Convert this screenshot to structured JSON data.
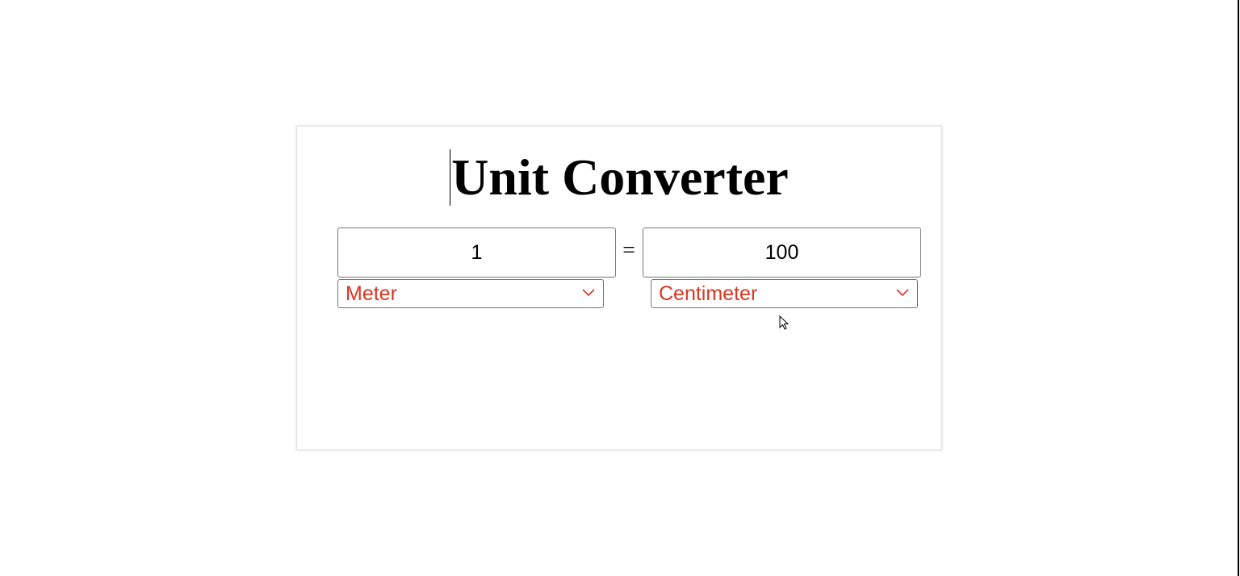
{
  "app": {
    "title": "Unit Converter"
  },
  "converter": {
    "from_value": "1",
    "to_value": "100",
    "equals_sign": "=",
    "from_unit": "Meter",
    "to_unit": "Centimeter"
  },
  "colors": {
    "select_text": "#d9361f",
    "text": "#000000",
    "border": "#767676"
  },
  "icons": {
    "dropdown": "chevron-down-icon",
    "pointer": "mouse-cursor-icon"
  }
}
